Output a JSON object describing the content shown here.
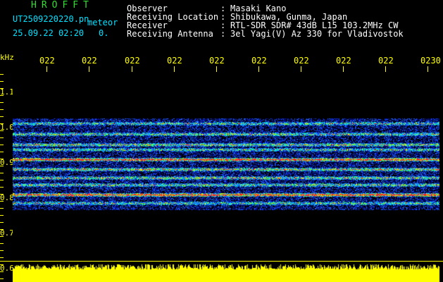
{
  "header": {
    "app_title": "HROFFT",
    "file_name": "UT2509220220.pn",
    "meteor_label": "meteor",
    "datetime": "25.09.22 02:20",
    "meteor_count": "0."
  },
  "info": [
    {
      "label": "Observer",
      "value": "Masaki Kano"
    },
    {
      "label": "Receiving Location",
      "value": "Shibukawa, Gunma, Japan"
    },
    {
      "label": "Receiver",
      "value": "RTL-SDR SDR# 43dB L15 103.2MHz CW"
    },
    {
      "label": "Receiving Antenna",
      "value": "3el Yagi(V) Az 330 for Vladivostok"
    }
  ],
  "time_axis": {
    "labels": [
      "022",
      "022",
      "022",
      "022",
      "022",
      "022",
      "022",
      "022",
      "022",
      "0230"
    ]
  },
  "freq_axis": {
    "unit": "kHz",
    "labels": [
      "1.1",
      "1.0",
      "0.9",
      "0.8",
      "0.7",
      "0.6"
    ]
  },
  "colors": {
    "axis": "#ffff00",
    "title": "#33dd33",
    "filename": "#00e0ff",
    "background": "#000000"
  }
}
